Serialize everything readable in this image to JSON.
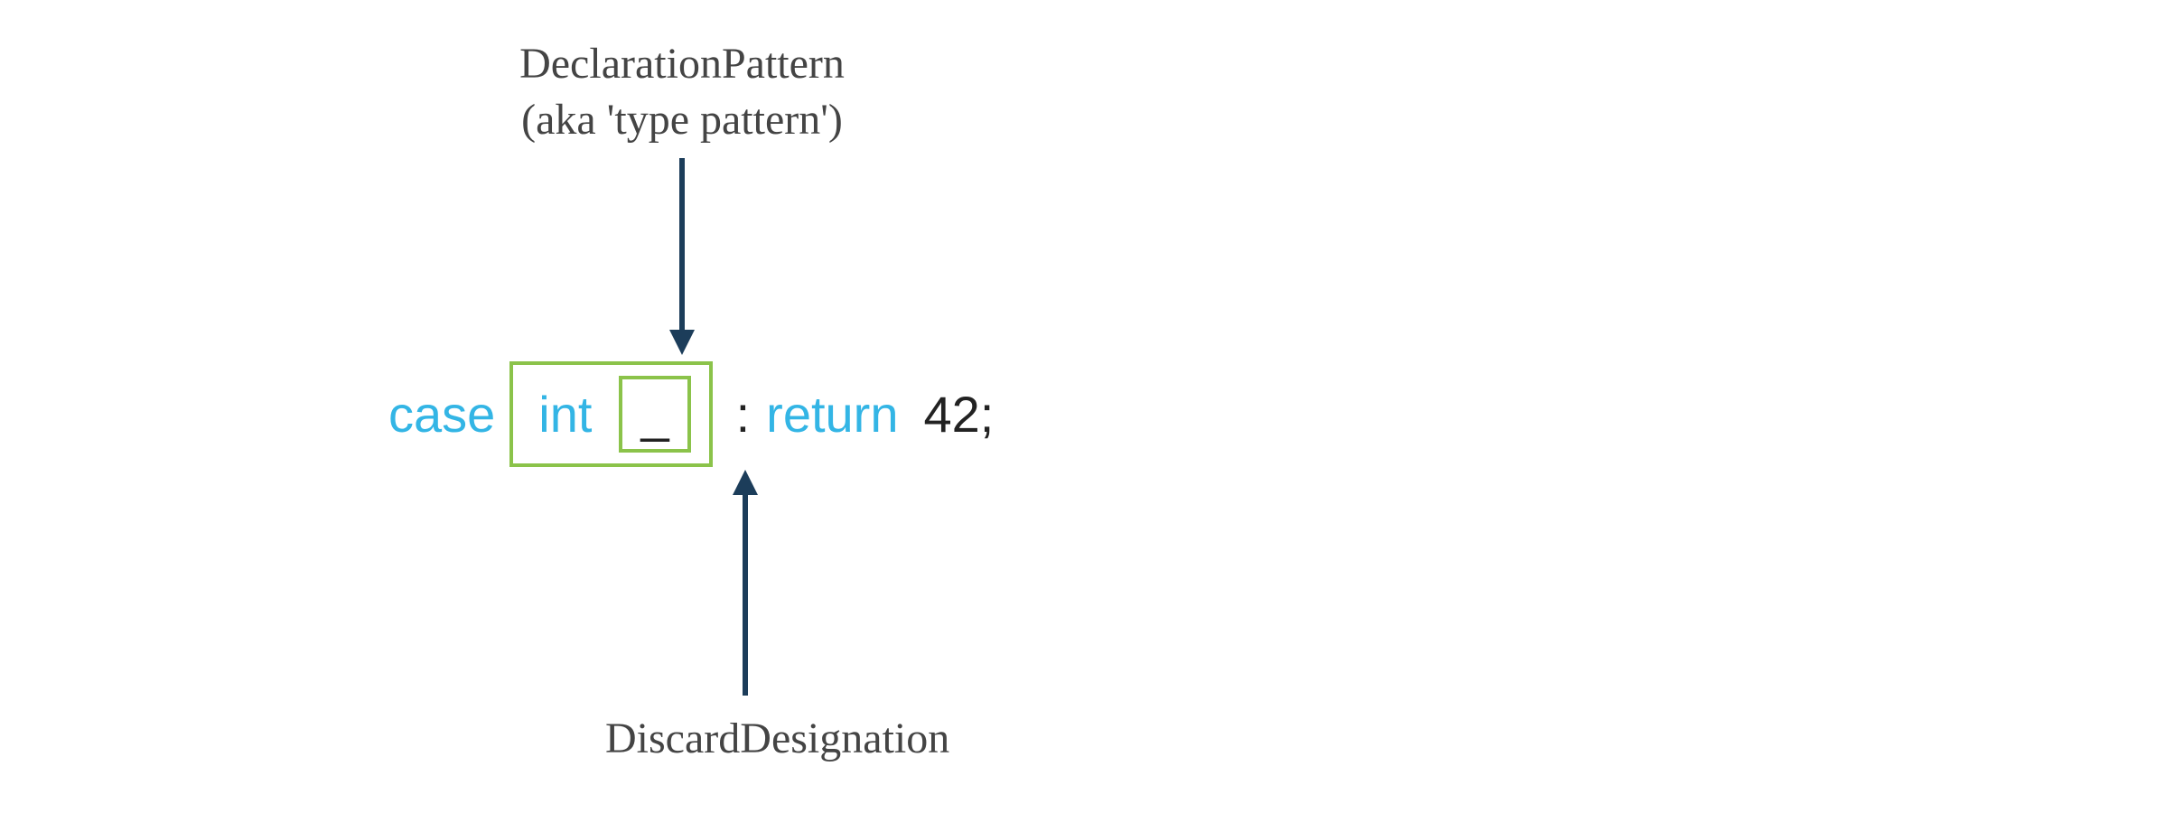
{
  "annotations": {
    "top_line1": "DeclarationPattern",
    "top_line2": "(aka 'type pattern')",
    "bottom": "DiscardDesignation"
  },
  "code": {
    "case": "case",
    "type": "int",
    "discard": "_",
    "colon": ":",
    "return": "return",
    "value": "42;"
  },
  "colors": {
    "keyword": "#33b5e5",
    "box": "#8bc34a",
    "arrow": "#1c3d5a",
    "text": "#444444"
  }
}
